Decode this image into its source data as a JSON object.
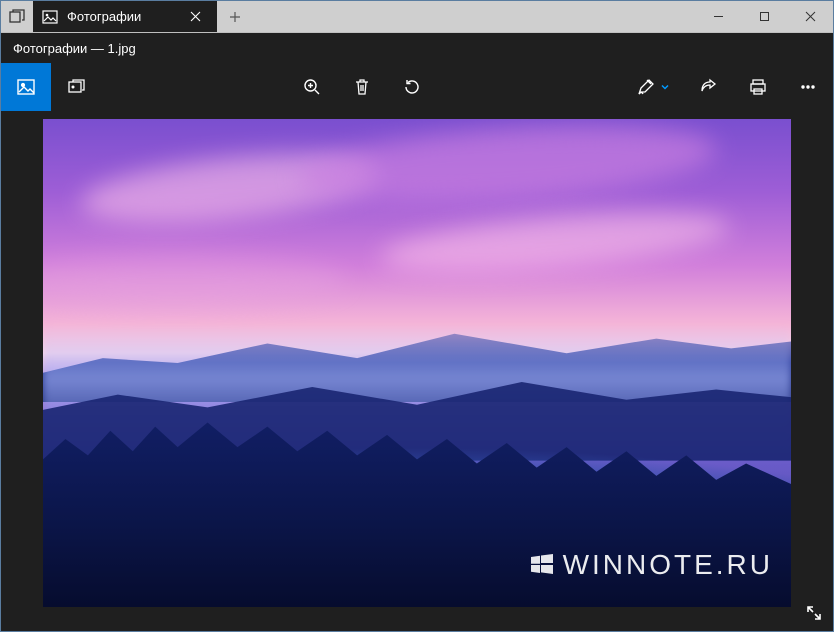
{
  "titlebar": {
    "title": "Фотографии"
  },
  "subheader": {
    "title": "Фотографии — 1.jpg"
  },
  "watermark": {
    "text": "WINNOTE.RU"
  }
}
